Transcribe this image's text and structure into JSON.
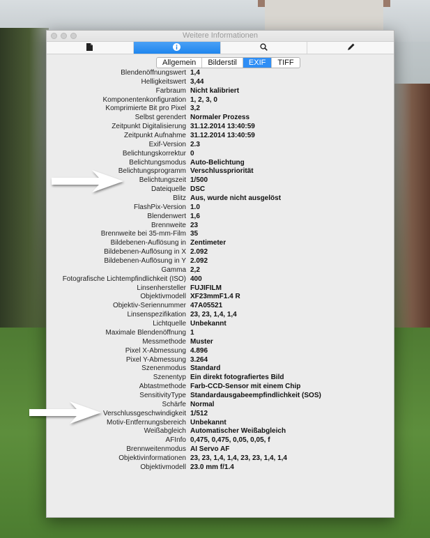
{
  "window": {
    "title": "Weitere Informationen"
  },
  "toolbar": {
    "items": [
      {
        "icon": "document-icon"
      },
      {
        "icon": "info-icon"
      },
      {
        "icon": "search-icon"
      },
      {
        "icon": "pencil-icon"
      }
    ],
    "active_index": 1,
    "accent_color": "#1f86ee"
  },
  "tabs": {
    "labels": [
      "Allgemein",
      "Bilderstil",
      "EXIF",
      "TIFF"
    ],
    "selected": "EXIF"
  },
  "exif_rows": [
    {
      "label": "Blendenöffnungswert",
      "value": "1,4"
    },
    {
      "label": "Helligkeitswert",
      "value": "3,44"
    },
    {
      "label": "Farbraum",
      "value": "Nicht kalibriert"
    },
    {
      "label": "Komponentenkonfiguration",
      "value": "1, 2, 3, 0"
    },
    {
      "label": "Komprimierte Bit pro Pixel",
      "value": "3,2"
    },
    {
      "label": "Selbst gerendert",
      "value": "Normaler Prozess"
    },
    {
      "label": "Zeitpunkt Digitalisierung",
      "value": "31.12.2014 13:40:59"
    },
    {
      "label": "Zeitpunkt Aufnahme",
      "value": "31.12.2014 13:40:59"
    },
    {
      "label": "Exif-Version",
      "value": "2.3"
    },
    {
      "label": "Belichtungskorrektur",
      "value": "0"
    },
    {
      "label": "Belichtungsmodus",
      "value": "Auto-Belichtung"
    },
    {
      "label": "Belichtungsprogramm",
      "value": "Verschlusspriorität"
    },
    {
      "label": "Belichtungszeit",
      "value": "1/500"
    },
    {
      "label": "Dateiquelle",
      "value": "DSC"
    },
    {
      "label": "Blitz",
      "value": "Aus, wurde nicht ausgelöst"
    },
    {
      "label": "FlashPix-Version",
      "value": "1.0"
    },
    {
      "label": "Blendenwert",
      "value": "1,6"
    },
    {
      "label": "Brennweite",
      "value": "23"
    },
    {
      "label": "Brennweite bei 35-mm-Film",
      "value": "35"
    },
    {
      "label": "Bildebenen-Auflösung in",
      "value": "Zentimeter"
    },
    {
      "label": "Bildebenen-Auflösung in X",
      "value": "2.092"
    },
    {
      "label": "Bildebenen-Auflösung in Y",
      "value": "2.092"
    },
    {
      "label": "Gamma",
      "value": "2,2"
    },
    {
      "label": "Fotografische Lichtempfindlichkeit (ISO)",
      "value": "400"
    },
    {
      "label": "Linsenhersteller",
      "value": "FUJIFILM"
    },
    {
      "label": "Objektivmodell",
      "value": "XF23mmF1.4 R"
    },
    {
      "label": "Objektiv-Seriennummer",
      "value": "47A05521"
    },
    {
      "label": "Linsenspezifikation",
      "value": "23, 23, 1,4, 1,4"
    },
    {
      "label": "Lichtquelle",
      "value": "Unbekannt"
    },
    {
      "label": "Maximale Blendenöffnung",
      "value": "1"
    },
    {
      "label": "Messmethode",
      "value": "Muster"
    },
    {
      "label": "Pixel X-Abmessung",
      "value": "4.896"
    },
    {
      "label": "Pixel Y-Abmessung",
      "value": "3.264"
    },
    {
      "label": "Szenenmodus",
      "value": "Standard"
    },
    {
      "label": "Szenentyp",
      "value": "Ein direkt fotografiertes Bild"
    },
    {
      "label": "Abtastmethode",
      "value": "Farb-CCD-Sensor mit einem Chip"
    },
    {
      "label": "SensitivityType",
      "value": "Standardausgabeempfindlichkeit (SOS)"
    },
    {
      "label": "Schärfe",
      "value": "Normal"
    },
    {
      "label": "Verschlussgeschwindigkeit",
      "value": "1/512"
    },
    {
      "label": "Motiv-Entfernungsbereich",
      "value": "Unbekannt"
    },
    {
      "label": "Weißabgleich",
      "value": "Automatischer Weißabgleich"
    },
    {
      "label": "AFInfo",
      "value": "0,475, 0,475, 0,05, 0,05, f"
    },
    {
      "label": "Brennweitenmodus",
      "value": "AI Servo AF"
    },
    {
      "label": "Objektivinformationen",
      "value": "23, 23, 1,4, 1,4, 23, 23, 1,4, 1,4"
    },
    {
      "label": "Objektivmodell",
      "value": "23.0 mm f/1.4"
    }
  ],
  "annotation_arrows": {
    "color": "#ffffff"
  }
}
